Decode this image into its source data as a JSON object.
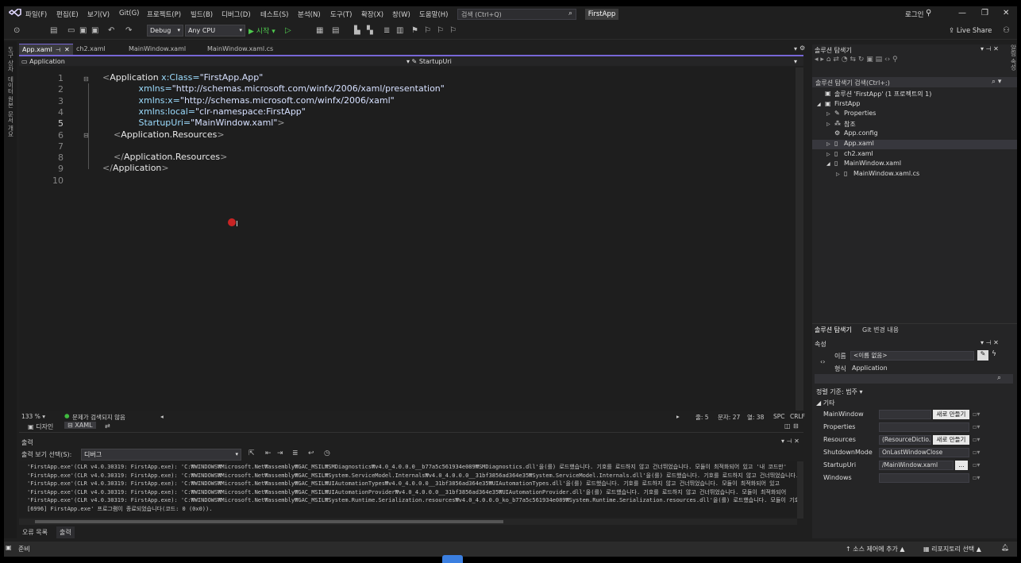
{
  "window": {
    "menu": [
      "파일(F)",
      "편집(E)",
      "보기(V)",
      "Git(G)",
      "프로젝트(P)",
      "빌드(B)",
      "디버그(D)",
      "테스트(S)",
      "분석(N)",
      "도구(T)",
      "확장(X)",
      "창(W)",
      "도움말(H)"
    ],
    "search_placeholder": "검색 (Ctrl+Q)",
    "project_name": "FirstApp",
    "login": "로그인",
    "live_share": "Live Share"
  },
  "toolbar": {
    "config": "Debug",
    "platform": "Any CPU",
    "start_label": "▶ 시작 ▾"
  },
  "left_strip": [
    "도구 상자",
    "데이터 원본",
    "문서 개요",
    "속성"
  ],
  "doc_tabs": [
    "App.xaml",
    "ch2.xaml",
    "MainWindow.xaml",
    "MainWindow.xaml.cs"
  ],
  "nav": {
    "left": "Application",
    "right": "StartupUri"
  },
  "editor": {
    "line_numbers": [
      "1",
      "2",
      "3",
      "4",
      "5",
      "6",
      "7",
      "8",
      "9",
      "10"
    ],
    "current_line": "5",
    "lines": [
      {
        "open": "<",
        "tag": "Application",
        "attr": " x:Class=",
        "val": "\"FirstApp.App\"",
        "close": ""
      },
      {
        "indent": "             ",
        "attr": "xmlns=",
        "val": "\"http://schemas.microsoft.com/winfx/2006/xaml/presentation\""
      },
      {
        "indent": "             ",
        "attr": "xmlns:x=",
        "val": "\"http://schemas.microsoft.com/winfx/2006/xaml\""
      },
      {
        "indent": "             ",
        "attr": "xmlns:local=",
        "val": "\"clr-namespace:FirstApp\""
      },
      {
        "indent": "             ",
        "attr": "StartupUri=",
        "val": "\"MainWindow.xaml\"",
        "close": ">"
      },
      {
        "indent": "    ",
        "open": "<",
        "tag": "Application.Resources",
        "close": ">"
      },
      {
        "indent": ""
      },
      {
        "indent": "    ",
        "open": "</",
        "tag": "Application.Resources",
        "close": ">"
      },
      {
        "indent": "",
        "open": "</",
        "tag": "Application",
        "close": ">"
      },
      {
        "indent": ""
      }
    ]
  },
  "editor_status": {
    "zoom": "133 %",
    "issues": "문제가 검색되지 않음",
    "line": "줄: 5",
    "char": "문자: 27",
    "col": "열: 38",
    "spc": "SPC",
    "crlf": "CRLF"
  },
  "view_tabs": {
    "design": "디자인",
    "xaml": "XAML"
  },
  "output": {
    "title": "출력",
    "source_label": "출력 보기 선택(S):",
    "source_value": "디버그",
    "lines": [
      "'FirstApp.exe'(CLR v4.0.30319: FirstApp.exe): 'C:₩WINDOWS₩Microsoft.Net₩assembly₩GAC_MSIL₩SMDiagnostics₩v4.0_4.0.0.0__b77a5c561934e089₩SMDiagnostics.dll'을(를) 로드했습니다. 기호를 로드하지 않고 건너뛰었습니다. 모듈이 최적화되어 있고 '내 코드만'",
      "'FirstApp.exe'(CLR v4.0.30319: FirstApp.exe): 'C:₩WINDOWS₩Microsoft.Net₩assembly₩GAC_MSIL₩System.ServiceModel.Internals₩v4.0_4.0.0.0__31bf3856ad364e35₩System.ServiceModel.Internals.dll'을(를) 로드했습니다. 기호를 로드하지 않고 건너뛰었습니다.",
      "'FirstApp.exe'(CLR v4.0.30319: FirstApp.exe): 'C:₩WINDOWS₩Microsoft.Net₩assembly₩GAC_MSIL₩UIAutomationTypes₩v4.0_4.0.0.0__31bf3856ad364e35₩UIAutomationTypes.dll'을(를) 로드했습니다. 기호를 로드하지 않고 건너뛰었습니다. 모듈이 최적화되어 있고",
      "'FirstApp.exe'(CLR v4.0.30319: FirstApp.exe): 'C:₩WINDOWS₩Microsoft.Net₩assembly₩GAC_MSIL₩UIAutomationProvider₩v4.0_4.0.0.0__31bf3856ad364e35₩UIAutomationProvider.dll'을(를) 로드했습니다. 기호를 로드하지 않고 건너뛰었습니다. 모듈이 최적화되어",
      "'FirstApp.exe'(CLR v4.0.30319: FirstApp.exe): 'C:₩WINDOWS₩Microsoft.Net₩assembly₩GAC_MSIL₩System.Runtime.Serialization.resources₩v4.0_4.0.0.0_ko_b77a5c561934e089₩System.Runtime.Serialization.resources.dll'을(를) 로드했습니다. 모듈이 기호 없이",
      "[6996] FirstApp.exe' 프로그램이 종료되었습니다(코드: 0 (0x0))."
    ]
  },
  "bottom_tabs": [
    "오류 목록",
    "출력"
  ],
  "solution_explorer": {
    "title": "솔루션 탐색기",
    "search_placeholder": "솔루션 탐색기 검색(Ctrl+;)",
    "items": [
      {
        "label": "솔루션 'FirstApp' (1 프로젝트의 1)",
        "icon": "solution-icon",
        "expander": ""
      },
      {
        "label": "FirstApp",
        "icon": "project-icon",
        "expander": "◢"
      },
      {
        "label": "Properties",
        "icon": "wrench-icon",
        "expander": "▷"
      },
      {
        "label": "참조",
        "icon": "references-icon",
        "expander": "▷"
      },
      {
        "label": "App.config",
        "icon": "config-file-icon",
        "expander": ""
      },
      {
        "label": "App.xaml",
        "icon": "xaml-file-icon",
        "expander": "▷"
      },
      {
        "label": "ch2.xaml",
        "icon": "xaml-file-icon",
        "expander": "▷"
      },
      {
        "label": "MainWindow.xaml",
        "icon": "xaml-file-icon",
        "expander": "◢"
      },
      {
        "label": "MainWindow.xaml.cs",
        "icon": "cs-file-icon",
        "expander": "▷"
      }
    ],
    "selected_index": 5,
    "bottom_tabs": [
      "솔루션 탐색기",
      "Git 변경 내용"
    ]
  },
  "properties": {
    "title": "속성",
    "name_label": "이름",
    "name_value": "<이름 없음>",
    "type_label": "형식",
    "type_value": "Application",
    "sort_label": "정렬 기준: 범주 ▾",
    "category": "기타",
    "rows": [
      {
        "name": "MainWindow",
        "value": "",
        "button": "새로 만들기"
      },
      {
        "name": "Properties",
        "value": "",
        "button": ""
      },
      {
        "name": "Resources",
        "value": "(ResourceDictio...",
        "button": "새로 만들기"
      },
      {
        "name": "ShutdownMode",
        "value": "OnLastWindowClose",
        "button": ""
      },
      {
        "name": "StartupUri",
        "value": "/MainWindow.xaml",
        "button": "..."
      },
      {
        "name": "Windows",
        "value": "",
        "button": ""
      }
    ]
  },
  "status_bar": {
    "ready": "준비",
    "source_control": "소스 제어에 추가 ▲",
    "repository": "리포지토리 선택 ▲"
  },
  "colors": {
    "accent": "#7767d6",
    "editor_bg": "#1e1e1e",
    "chrome_bg": "#1f1f1f",
    "attr_color": "#9cdcfe"
  }
}
